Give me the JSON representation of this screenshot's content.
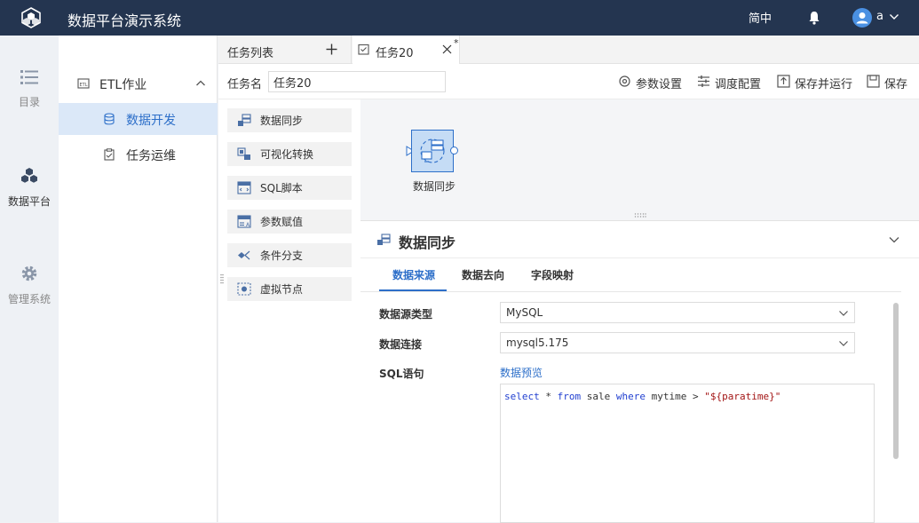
{
  "app": {
    "title": "数据平台演示系统",
    "language": "简中",
    "user": "a"
  },
  "leftnav": {
    "items": [
      {
        "label": "目录",
        "icon": "list-icon"
      },
      {
        "label": "数据平台",
        "icon": "cubes-icon"
      },
      {
        "label": "管理系统",
        "icon": "gear-icon"
      }
    ]
  },
  "tree": {
    "group": "ETL作业",
    "items": [
      {
        "label": "数据开发",
        "icon": "database-icon"
      },
      {
        "label": "任务运维",
        "icon": "clipboard-icon"
      }
    ]
  },
  "tabs": {
    "list_label": "任务列表",
    "task_label": "任务20",
    "modified_marker": "*"
  },
  "toolbar": {
    "task_name_label": "任务名",
    "task_name_value": "任务20",
    "buttons": [
      {
        "label": "参数设置",
        "icon": "gear-icon"
      },
      {
        "label": "调度配置",
        "icon": "sliders-icon"
      },
      {
        "label": "保存并运行",
        "icon": "save-run-icon"
      },
      {
        "label": "保存",
        "icon": "save-icon"
      }
    ]
  },
  "palette": {
    "items": [
      {
        "label": "数据同步",
        "icon": "data-sync-icon"
      },
      {
        "label": "可视化转换",
        "icon": "visual-transform-icon"
      },
      {
        "label": "SQL脚本",
        "icon": "sql-script-icon"
      },
      {
        "label": "参数赋值",
        "icon": "param-assign-icon"
      },
      {
        "label": "条件分支",
        "icon": "condition-branch-icon"
      },
      {
        "label": "虚拟节点",
        "icon": "virtual-node-icon"
      }
    ]
  },
  "canvas": {
    "node_label": "数据同步"
  },
  "panel": {
    "title": "数据同步",
    "tabs": [
      "数据来源",
      "数据去向",
      "字段映射"
    ],
    "active_tab": "数据来源",
    "fields": {
      "source_type_label": "数据源类型",
      "source_type_value": "MySQL",
      "connection_label": "数据连接",
      "connection_value": "mysql5.175",
      "sql_label": "SQL语句",
      "preview_link": "数据预览"
    },
    "sql": {
      "kw_select": "select",
      "star": " * ",
      "kw_from": "from",
      "table": " sale ",
      "kw_where": "where",
      "cond": " mytime > ",
      "literal": "\"${paratime}\""
    }
  },
  "colors": {
    "header": "#243550",
    "accent": "#2d6fc9",
    "active_bg": "#dbe8f8"
  }
}
